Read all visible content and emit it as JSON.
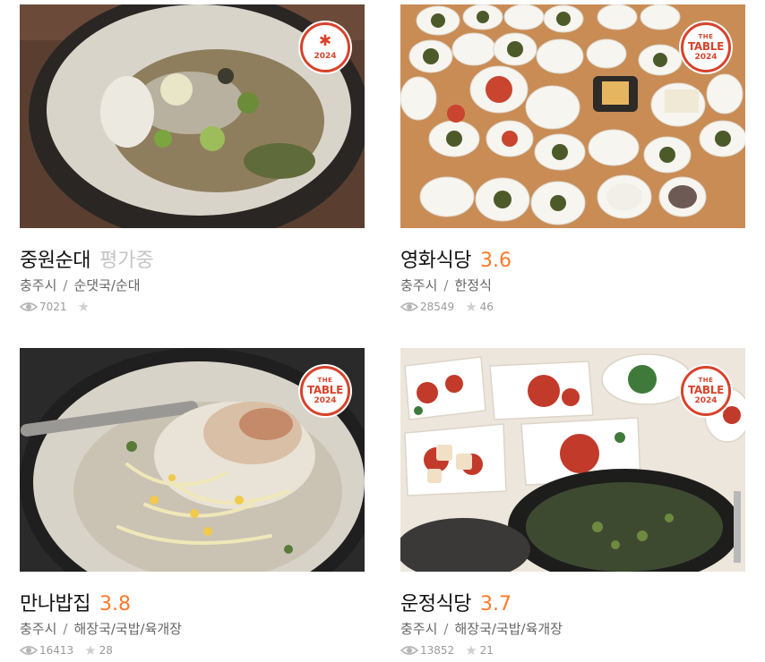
{
  "restaurants": [
    {
      "name": "중원순대",
      "score": "평가중",
      "score_pending": true,
      "region": "충주시",
      "category": "순댓국/순대",
      "views": "7021",
      "stars": "",
      "badge": {
        "type": "award",
        "icon": "asterisk-emblem-icon",
        "year": "2024"
      }
    },
    {
      "name": "영화식당",
      "score": "3.6",
      "score_pending": false,
      "region": "충주시",
      "category": "한정식",
      "views": "28549",
      "stars": "46",
      "badge": {
        "type": "the-table",
        "line1": "THE",
        "line2": "TABLE",
        "year": "2024"
      }
    },
    {
      "name": "만나밥집",
      "score": "3.8",
      "score_pending": false,
      "region": "충주시",
      "category": "해장국/국밥/육개장",
      "views": "16413",
      "stars": "28",
      "badge": {
        "type": "the-table",
        "line1": "THE",
        "line2": "TABLE",
        "year": "2024"
      }
    },
    {
      "name": "운정식당",
      "score": "3.7",
      "score_pending": false,
      "region": "충주시",
      "category": "해장국/국밥/육개장",
      "views": "13852",
      "stars": "21",
      "badge": {
        "type": "the-table",
        "line1": "THE",
        "line2": "TABLE",
        "year": "2024"
      }
    }
  ],
  "separator": "/",
  "colors": {
    "score": "#ff792a",
    "score_pending": "#c5c5c5",
    "badge": "#d8432b",
    "name": "#111111",
    "meta": "#666666",
    "stats": "#9a9a9a"
  },
  "icons": {
    "views": "eye-icon",
    "stars": "star-icon"
  }
}
